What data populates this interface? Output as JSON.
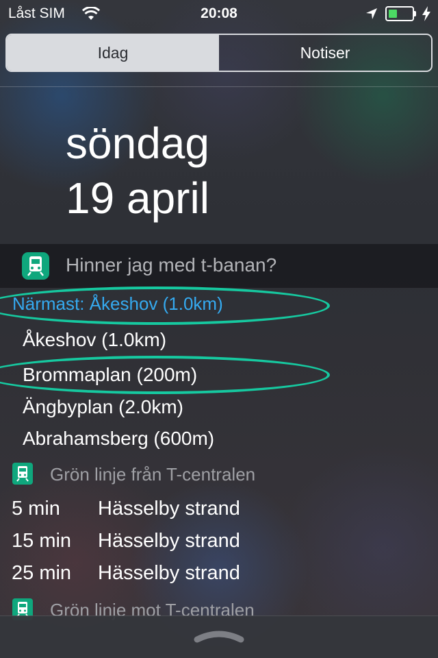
{
  "status_bar": {
    "carrier": "Låst SIM",
    "time": "20:08",
    "battery_level": 0.35,
    "battery_color": "#4cd964",
    "icons": [
      "wifi-icon",
      "location-icon",
      "battery-icon",
      "charging-icon"
    ]
  },
  "tabs": [
    {
      "label": "Idag",
      "selected": true
    },
    {
      "label": "Notiser",
      "selected": false
    }
  ],
  "date": {
    "weekday": "söndag",
    "date": "19 april"
  },
  "widget": {
    "title": "Hinner jag med t-banan?",
    "app_icon": "train-icon",
    "accent_color": "#0fa77d",
    "nearest": "Närmast: Åkeshov (1.0km)",
    "stations": [
      {
        "label": "Åkeshov (1.0km)"
      },
      {
        "label": "Brommaplan (200m)"
      },
      {
        "label": "Ängbyplan (2.0km)"
      },
      {
        "label": "Abrahamsberg (600m)"
      }
    ],
    "sections": [
      {
        "title": "Grön linje från T-centralen",
        "departures": [
          {
            "time": "5 min",
            "destination": "Hässelby strand"
          },
          {
            "time": "15 min",
            "destination": "Hässelby strand"
          },
          {
            "time": "25 min",
            "destination": "Hässelby strand"
          }
        ]
      },
      {
        "title": "Grön linje mot T-centralen",
        "departures": []
      }
    ]
  },
  "annotation_color": "#16c9a0",
  "link_color": "#35aaf0",
  "bottom_handle_icon": "chevron-up-handle-icon"
}
